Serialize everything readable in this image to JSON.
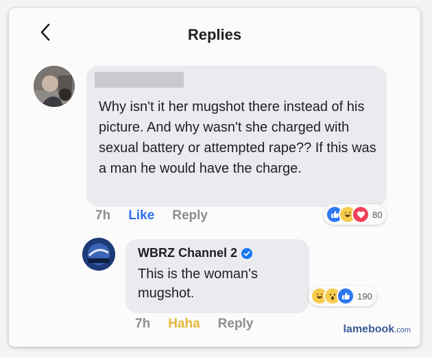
{
  "header": {
    "title": "Replies",
    "back_icon": "chevron-left-icon"
  },
  "comment": {
    "text": "Why isn't it her mugshot there instead of his picture. And why wasn't she charged with sexual battery or attempted rape?? If this was a man he would have the charge.",
    "time": "7h",
    "like_label": "Like",
    "reply_label": "Reply",
    "reactions": {
      "icons": [
        "like-icon",
        "haha-icon",
        "love-icon"
      ],
      "count": "80"
    }
  },
  "reply": {
    "author": "WBRZ Channel 2",
    "text": "This is the woman's mugshot.",
    "time": "7h",
    "reaction_label": "Haha",
    "reply_label": "Reply",
    "reactions": {
      "icons": [
        "haha-icon",
        "wow-icon",
        "like-icon"
      ],
      "count": "190"
    }
  },
  "watermark": {
    "brand": "lamebook",
    "domain": ".com"
  },
  "colors": {
    "like_blue": "#2d6ee8",
    "haha_yellow": "#e3b93a",
    "bubble_gray": "#e9ebef",
    "text_dark": "#1c1e21",
    "meta_gray": "#8a8d91",
    "verified_blue": "#1877f2"
  }
}
